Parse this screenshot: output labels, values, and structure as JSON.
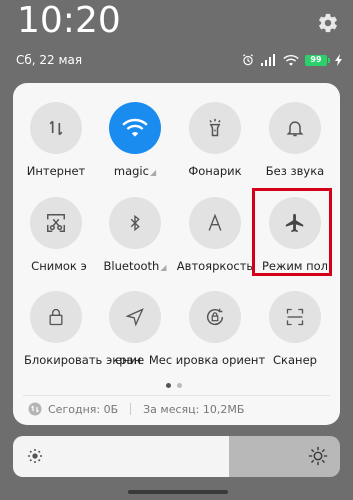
{
  "status_bar": {
    "time": "10:20",
    "date": "Сб, 22 мая",
    "battery": "99",
    "icons": [
      "alarm-icon",
      "signal-icon",
      "wifi-icon",
      "battery-icon",
      "charging-icon"
    ]
  },
  "tiles": [
    {
      "label": "Интернет",
      "icon": "data-transfer-icon",
      "active": false
    },
    {
      "label": "magic",
      "icon": "wifi-icon",
      "active": true,
      "has_dropdown": true
    },
    {
      "label": "Фонарик",
      "icon": "flashlight-icon",
      "active": false
    },
    {
      "label": "Без звука",
      "icon": "bell-icon",
      "active": false
    },
    {
      "label": "Снимок э",
      "icon": "screenshot-scissors-icon",
      "active": false
    },
    {
      "label": "Bluetooth",
      "icon": "bluetooth-icon",
      "active": false,
      "has_dropdown": true
    },
    {
      "label": "Автояркость",
      "icon": "auto-brightness-icon",
      "active": false
    },
    {
      "label": "Режим пол",
      "icon": "airplane-icon",
      "active": false
    },
    {
      "label": "Блокировать экран",
      "icon": "lock-icon",
      "active": false
    },
    {
      "label": "ение",
      "icon": "location-arrow-icon",
      "active": false
    },
    {
      "label": "Мес ировка ориент",
      "icon": "rotation-lock-icon",
      "active": false
    },
    {
      "label": "Сканер",
      "icon": "scanner-icon",
      "active": false
    }
  ],
  "pager": {
    "pages": 2,
    "current": 1
  },
  "data_usage": {
    "today": "Сегодня: 0Б",
    "month": "За месяц: 10,2МБ"
  },
  "brightness": {
    "level": 0.66
  },
  "colors": {
    "accent": "#1a8cf0",
    "highlight": "#d4001a",
    "panel": "#f7f7f7",
    "background": "#6e6e6e"
  }
}
